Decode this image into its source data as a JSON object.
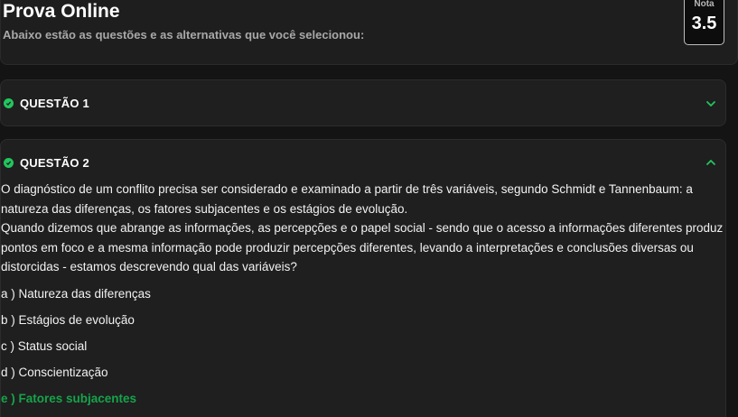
{
  "header": {
    "title": "Prova Online",
    "subtitle": "Abaixo estão as questões e as alternativas que você selecionou:",
    "grade_label": "Nota",
    "grade_value": "3.5"
  },
  "questions": [
    {
      "title": "QUESTÃO 1",
      "status_icon": "check-circle-icon",
      "expanded": false
    },
    {
      "title": "QUESTÃO 2",
      "status_icon": "check-circle-icon",
      "expanded": true,
      "statement_1": "O diagnóstico de um conflito precisa ser considerado e examinado a partir de três variáveis, segundo Schmidt e Tannenbaum: a natureza das diferenças, os fatores subjacentes e os estágios de evolução.",
      "statement_2": "Quando dizemos que abrange as informações, as percepções e o papel social - sendo que o acesso a informações diferentes produz pontos em foco e a mesma informação pode produzir percepções diferentes, levando a interpretações e conclusões diversas ou distorcidas - estamos descrevendo qual das variáveis?",
      "options": [
        {
          "label": "a ) Natureza das diferenças",
          "selected": false
        },
        {
          "label": "b ) Estágios de evolução",
          "selected": false
        },
        {
          "label": "c ) Status social",
          "selected": false
        },
        {
          "label": "d ) Conscientização",
          "selected": false
        },
        {
          "label": "e ) Fatores subjacentes",
          "selected": true
        }
      ]
    }
  ],
  "colors": {
    "background": "#141414",
    "card": "#1f1f1f",
    "success": "#22c55e",
    "selected_answer": "#16a34a"
  }
}
